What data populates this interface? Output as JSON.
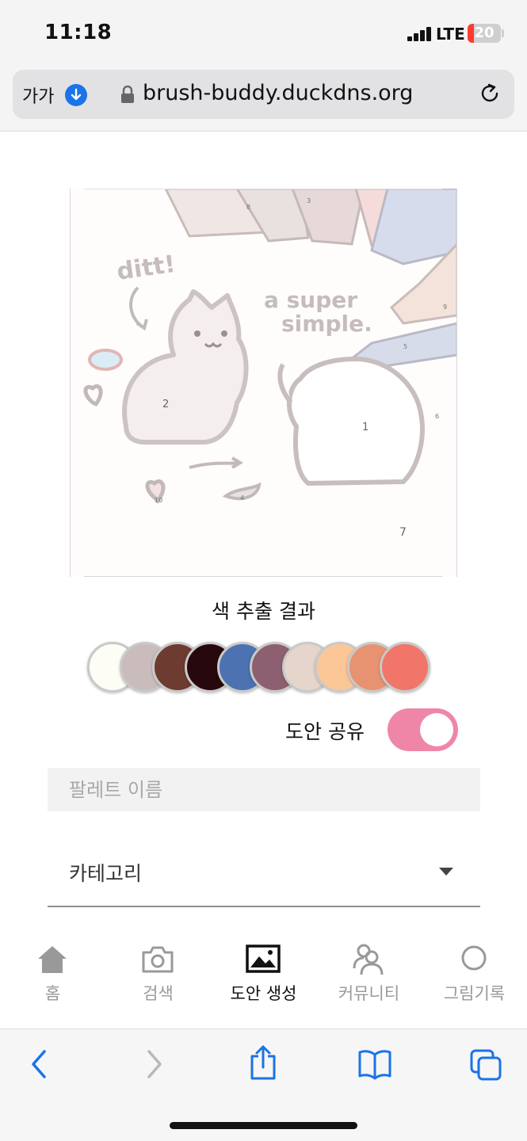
{
  "status_bar": {
    "time": "11:18",
    "network": "LTE",
    "battery": "20",
    "battery_percent": 20
  },
  "browser": {
    "text_size_label": "가가",
    "url": "brush-buddy.duckdns.org"
  },
  "main": {
    "extraction_title": "색 추출 결과",
    "swatches": [
      "#fdfdf5",
      "#c9bcbb",
      "#6e3b31",
      "#27080c",
      "#4d72b1",
      "#8c6070",
      "#e6d5ca",
      "#fcc797",
      "#e79371",
      "#f17569"
    ],
    "share_label": "도안 공유",
    "share_enabled": true,
    "palette_name_placeholder": "팔레트 이름",
    "palette_name_value": "",
    "category_label": "카테고리"
  },
  "image_labels": {
    "handwriting_1": "ditt!",
    "handwriting_2": "a super",
    "handwriting_3": "simple.",
    "region_numbers": [
      "2",
      "1",
      "7",
      "10",
      "4",
      "5",
      "8",
      "3",
      "9",
      "6"
    ]
  },
  "app_nav": {
    "items": [
      {
        "label": "홈",
        "icon": "home-icon",
        "active": false
      },
      {
        "label": "검색",
        "icon": "camera-icon",
        "active": false
      },
      {
        "label": "도안 생성",
        "icon": "image-icon",
        "active": true
      },
      {
        "label": "커뮤니티",
        "icon": "community-icon",
        "active": false
      },
      {
        "label": "그림기록",
        "icon": "circle-icon",
        "active": false
      }
    ]
  },
  "safari_toolbar": {
    "icons": [
      "back-icon",
      "forward-icon",
      "share-icon",
      "bookmarks-icon",
      "tabs-icon"
    ]
  },
  "colors": {
    "accent_blue": "#1a73e8",
    "toggle_pink": "#ef86a8",
    "battery_red": "#ff3b30"
  }
}
